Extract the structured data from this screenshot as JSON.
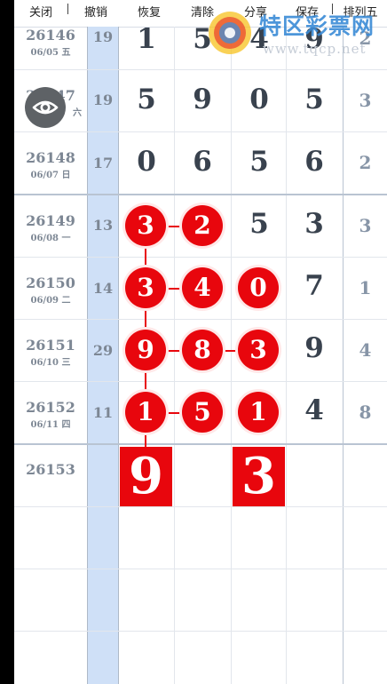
{
  "toolbar": {
    "items": [
      "关闭",
      "撤销",
      "恢复",
      "清除",
      "分享",
      "保存",
      "排列五"
    ]
  },
  "watermark": {
    "brand": "特区彩票网",
    "url": "www.tqcp.net"
  },
  "rows": [
    {
      "period": "26146",
      "date": "06/05 五",
      "sum": "19",
      "digits": [
        "1",
        "5",
        "4",
        "9"
      ],
      "span": "2"
    },
    {
      "period": "26147",
      "date": "六",
      "sum": "19",
      "digits": [
        "5",
        "9",
        "0",
        "5"
      ],
      "span": "3"
    },
    {
      "period": "26148",
      "date": "06/07 日",
      "sum": "17",
      "digits": [
        "0",
        "6",
        "5",
        "6"
      ],
      "span": "2"
    },
    {
      "period": "26149",
      "date": "06/08 一",
      "sum": "13",
      "digits": [
        "3",
        "2",
        "5",
        "3"
      ],
      "span": "3"
    },
    {
      "period": "26150",
      "date": "06/09 二",
      "sum": "14",
      "digits": [
        "3",
        "4",
        "0",
        "7"
      ],
      "span": "1"
    },
    {
      "period": "26151",
      "date": "06/10 三",
      "sum": "29",
      "digits": [
        "9",
        "8",
        "3",
        "9"
      ],
      "span": "4"
    },
    {
      "period": "26152",
      "date": "06/11 四",
      "sum": "11",
      "digits": [
        "1",
        "5",
        "1",
        "4"
      ],
      "span": "8"
    }
  ],
  "next_period": "26153",
  "predictions": [
    "9",
    "3"
  ],
  "colors": {
    "accent": "#e8060d",
    "sum_column": "#cfe0f7",
    "digit_text": "#39424e"
  },
  "floating_button_icon": "eye-icon"
}
